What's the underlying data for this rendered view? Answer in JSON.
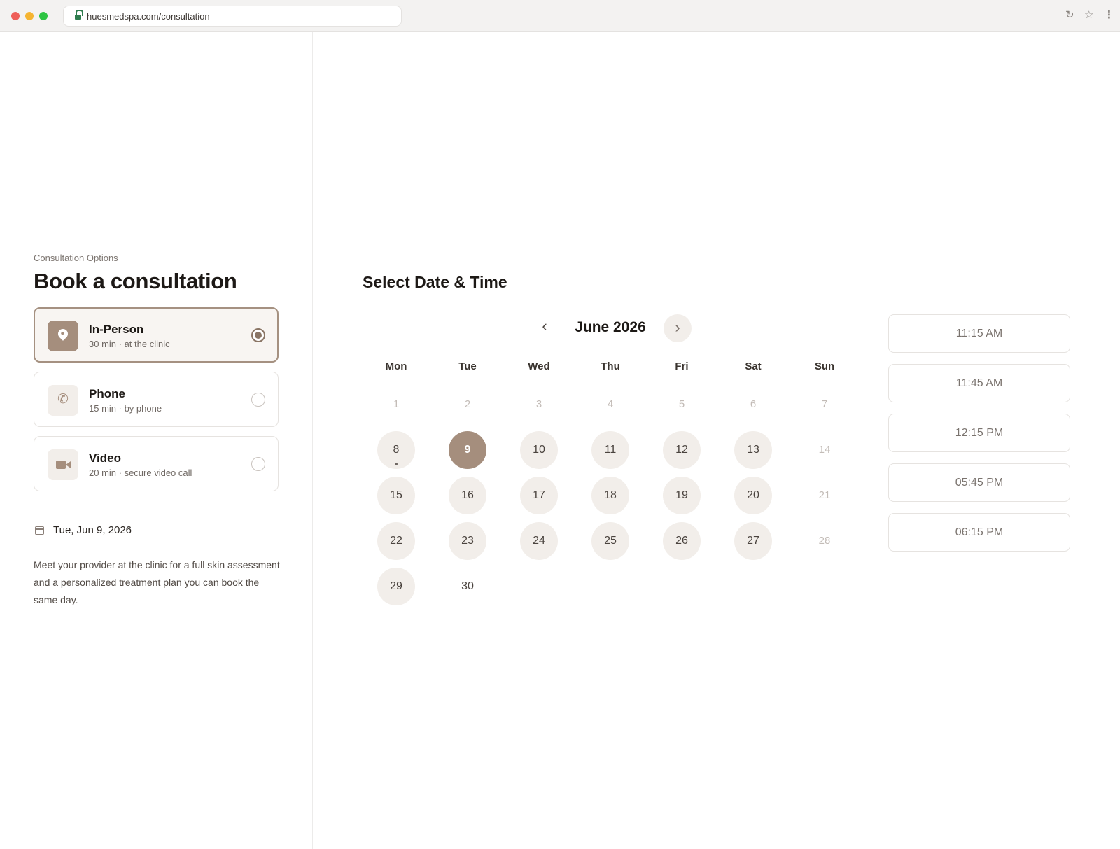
{
  "browser": {
    "url": "huesmedspa.com/consultation",
    "reload_icon": "reload-icon",
    "star_icon": "star-icon",
    "menu_icon": "kebab-menu-icon"
  },
  "left": {
    "eyebrow": "Consultation Options",
    "title": "Book a consultation",
    "options": [
      {
        "title": "In-Person",
        "subtitle": "30 min · at the clinic",
        "icon": "location-pin-icon",
        "selected": true
      },
      {
        "title": "Phone",
        "subtitle": "15 min · by phone",
        "icon": "phone-icon",
        "selected": false
      },
      {
        "title": "Video",
        "subtitle": "20 min · secure video call",
        "icon": "video-camera-icon",
        "selected": false
      }
    ],
    "selected_date": "Tue, Jun 9, 2026",
    "description": "Meet your provider at the clinic for a full skin assessment and a personalized treatment plan you can book the same day."
  },
  "calendar": {
    "section_title": "Select Date & Time",
    "month_label": "June 2026",
    "weekdays": [
      "Mon",
      "Tue",
      "Wed",
      "Thu",
      "Fri",
      "Sat",
      "Sun"
    ],
    "days": [
      {
        "d": "1",
        "state": "muted"
      },
      {
        "d": "2",
        "state": "muted"
      },
      {
        "d": "3",
        "state": "muted"
      },
      {
        "d": "4",
        "state": "muted"
      },
      {
        "d": "5",
        "state": "muted"
      },
      {
        "d": "6",
        "state": "muted"
      },
      {
        "d": "7",
        "state": "muted"
      },
      {
        "d": "8",
        "state": "avail",
        "today": true
      },
      {
        "d": "9",
        "state": "selected"
      },
      {
        "d": "10",
        "state": "avail"
      },
      {
        "d": "11",
        "state": "avail"
      },
      {
        "d": "12",
        "state": "avail"
      },
      {
        "d": "13",
        "state": "avail"
      },
      {
        "d": "14",
        "state": "muted"
      },
      {
        "d": "15",
        "state": "avail"
      },
      {
        "d": "16",
        "state": "avail"
      },
      {
        "d": "17",
        "state": "avail"
      },
      {
        "d": "18",
        "state": "avail"
      },
      {
        "d": "19",
        "state": "avail"
      },
      {
        "d": "20",
        "state": "avail"
      },
      {
        "d": "21",
        "state": "muted"
      },
      {
        "d": "22",
        "state": "avail"
      },
      {
        "d": "23",
        "state": "avail"
      },
      {
        "d": "24",
        "state": "avail"
      },
      {
        "d": "25",
        "state": "avail"
      },
      {
        "d": "26",
        "state": "avail"
      },
      {
        "d": "27",
        "state": "avail"
      },
      {
        "d": "28",
        "state": "muted"
      },
      {
        "d": "29",
        "state": "avail"
      },
      {
        "d": "30",
        "state": "plain"
      }
    ],
    "time_slots": [
      "11:15 AM",
      "11:45 AM",
      "12:15 PM",
      "05:45 PM",
      "06:15 PM"
    ]
  },
  "colors": {
    "accent": "#a58e7d",
    "accent_dark": "#8a7565",
    "chip_bg": "#f2eeea",
    "selected_card_bg": "#f8f5f2"
  }
}
